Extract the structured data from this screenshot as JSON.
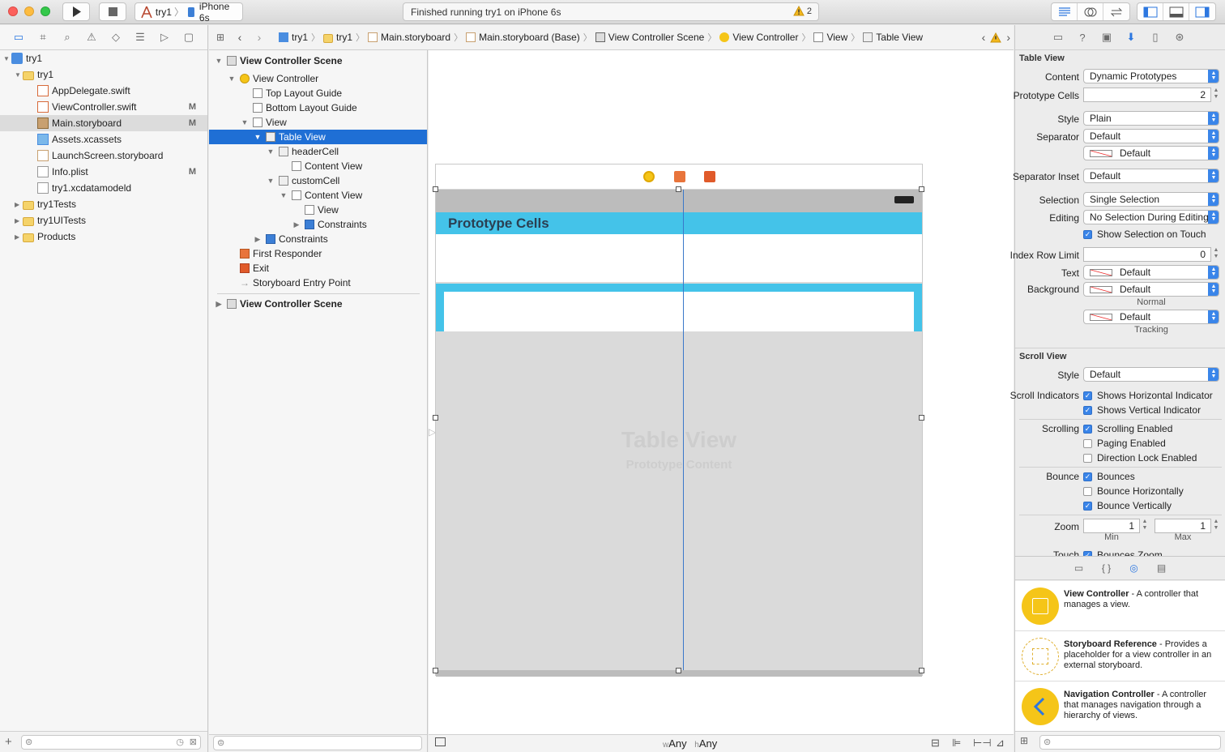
{
  "toolbar": {
    "scheme_project": "try1",
    "scheme_device": "iPhone 6s",
    "status_text": "Finished running try1 on iPhone 6s",
    "warning_count": "2"
  },
  "navigator": {
    "items": [
      {
        "label": "try1",
        "badge": ""
      },
      {
        "label": "try1",
        "badge": ""
      },
      {
        "label": "AppDelegate.swift",
        "badge": ""
      },
      {
        "label": "ViewController.swift",
        "badge": "M"
      },
      {
        "label": "Main.storyboard",
        "badge": "M"
      },
      {
        "label": "Assets.xcassets",
        "badge": ""
      },
      {
        "label": "LaunchScreen.storyboard",
        "badge": ""
      },
      {
        "label": "Info.plist",
        "badge": "M"
      },
      {
        "label": "try1.xcdatamodeld",
        "badge": ""
      },
      {
        "label": "try1Tests",
        "badge": ""
      },
      {
        "label": "try1UITests",
        "badge": ""
      },
      {
        "label": "Products",
        "badge": ""
      }
    ]
  },
  "jumpbar": {
    "crumbs": [
      "try1",
      "try1",
      "Main.storyboard",
      "Main.storyboard (Base)",
      "View Controller Scene",
      "View Controller",
      "View",
      "Table View"
    ]
  },
  "outline": {
    "items": [
      "View Controller Scene",
      "View Controller",
      "Top Layout Guide",
      "Bottom Layout Guide",
      "View",
      "Table View",
      "headerCell",
      "Content View",
      "customCell",
      "Content View",
      "View",
      "Constraints",
      "Constraints",
      "First Responder",
      "Exit",
      "Storyboard Entry Point",
      "View Controller Scene"
    ]
  },
  "canvas": {
    "header_cell_title": "Prototype Cells",
    "table_view_title": "Table View",
    "table_view_subtitle": "Prototype Content",
    "size_class_w_prefix": "w",
    "size_class_w": "Any",
    "size_class_h_prefix": "h",
    "size_class_h": "Any"
  },
  "inspector": {
    "table_view": {
      "section_title": "Table View",
      "content_label": "Content",
      "content_value": "Dynamic Prototypes",
      "prototype_cells_label": "Prototype Cells",
      "prototype_cells_value": "2",
      "style_label": "Style",
      "style_value": "Plain",
      "separator_label": "Separator",
      "separator_value": "Default",
      "separator_color_value": "Default",
      "separator_inset_label": "Separator Inset",
      "separator_inset_value": "Default",
      "selection_label": "Selection",
      "selection_value": "Single Selection",
      "editing_label": "Editing",
      "editing_value": "No Selection During Editing",
      "show_selection_touch": "Show Selection on Touch",
      "index_row_limit_label": "Index Row Limit",
      "index_row_limit_value": "0",
      "text_label": "Text",
      "text_value": "Default",
      "background_label": "Background",
      "background_value": "Default",
      "normal_caption": "Normal",
      "tracking_value": "Default",
      "tracking_caption": "Tracking"
    },
    "scroll_view": {
      "section_title": "Scroll View",
      "style_label": "Style",
      "style_value": "Default",
      "scroll_indicators_label": "Scroll Indicators",
      "shows_horizontal": "Shows Horizontal Indicator",
      "shows_vertical": "Shows Vertical Indicator",
      "scrolling_label": "Scrolling",
      "scrolling_enabled": "Scrolling Enabled",
      "paging_enabled": "Paging Enabled",
      "direction_lock": "Direction Lock Enabled",
      "bounce_label": "Bounce",
      "bounces": "Bounces",
      "bounce_horizontally": "Bounce Horizontally",
      "bounce_vertically": "Bounce Vertically",
      "zoom_label": "Zoom",
      "zoom_min": "1",
      "zoom_max": "1",
      "min_caption": "Min",
      "max_caption": "Max",
      "touch_label": "Touch",
      "bounces_zoom": "Bounces Zoom"
    },
    "checkboxes": {
      "show_selection_touch": true,
      "shows_horizontal": true,
      "shows_vertical": true,
      "scrolling_enabled": true,
      "paging_enabled": false,
      "direction_lock": false,
      "bounces": true,
      "bounce_horizontally": false,
      "bounce_vertically": true
    },
    "library": [
      {
        "title": "View Controller",
        "desc": " - A controller that manages a view."
      },
      {
        "title": "Storyboard Reference",
        "desc": " - Provides a placeholder for a view controller in an external storyboard."
      },
      {
        "title": "Navigation Controller",
        "desc": " - A controller that manages navigation through a hierarchy of views."
      }
    ]
  },
  "colors": {
    "accent": "#1f6fd5",
    "cell_cyan": "#44c3e9",
    "folder_yellow": "#f5d36a",
    "vc_yellow": "#f5c518"
  }
}
